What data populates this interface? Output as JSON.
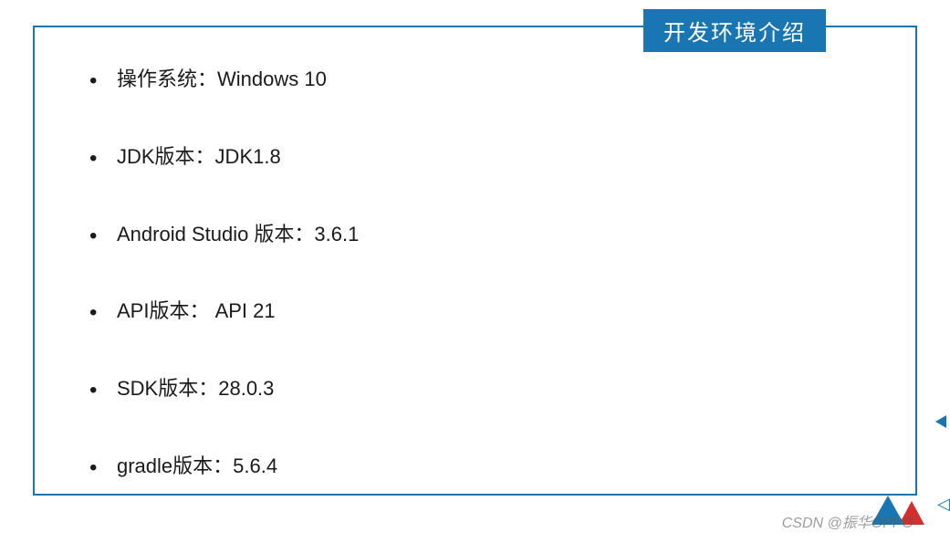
{
  "title": "开发环境介绍",
  "items": [
    "操作系统：Windows 10",
    "JDK版本：JDK1.8",
    " Android Studio 版本：3.6.1",
    "API版本：  API 21",
    "SDK版本：28.0.3",
    "gradle版本：5.6.4"
  ],
  "watermark": "CSDN @振华OPPO"
}
